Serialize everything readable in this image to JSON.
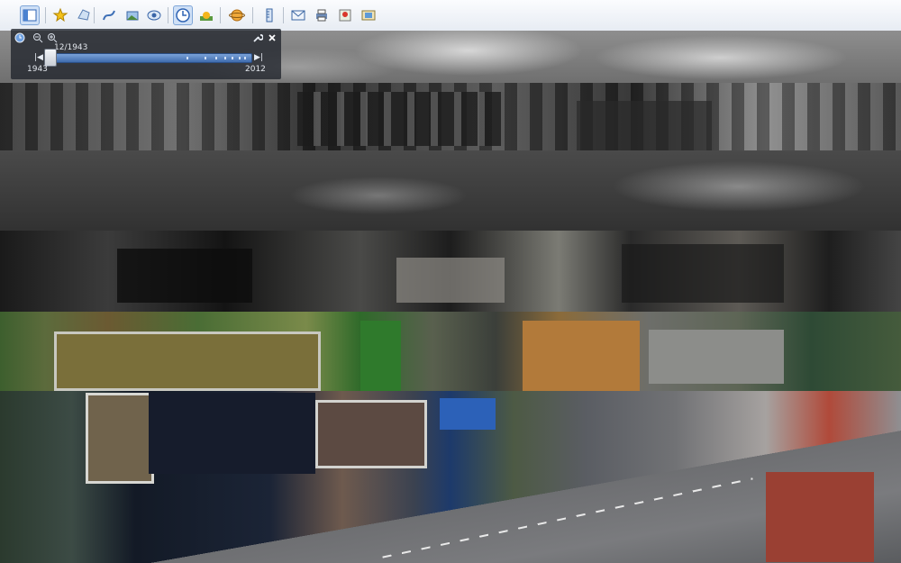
{
  "toolbar": {
    "icons": [
      "sidebar-toggle-icon",
      "placemark-icon",
      "polygon-icon",
      "path-icon",
      "image-overlay-icon",
      "record-tour-icon",
      "historical-imagery-icon",
      "sunlight-icon",
      "planet-icon",
      "ruler-icon",
      "email-icon",
      "print-icon",
      "google-maps-icon",
      "save-image-icon"
    ]
  },
  "time_slider": {
    "current_date": "12/1943",
    "start_year": "1943",
    "end_year": "2012",
    "position": 0.0,
    "controls": {
      "clock_icon": "clock-icon",
      "zoom_out_icon": "zoom-out-icon",
      "zoom_in_icon": "zoom-in-icon",
      "settings_icon": "wrench-icon",
      "close_icon": "close-icon",
      "prev_glyph": "|◀",
      "next_glyph": "▶|"
    }
  }
}
